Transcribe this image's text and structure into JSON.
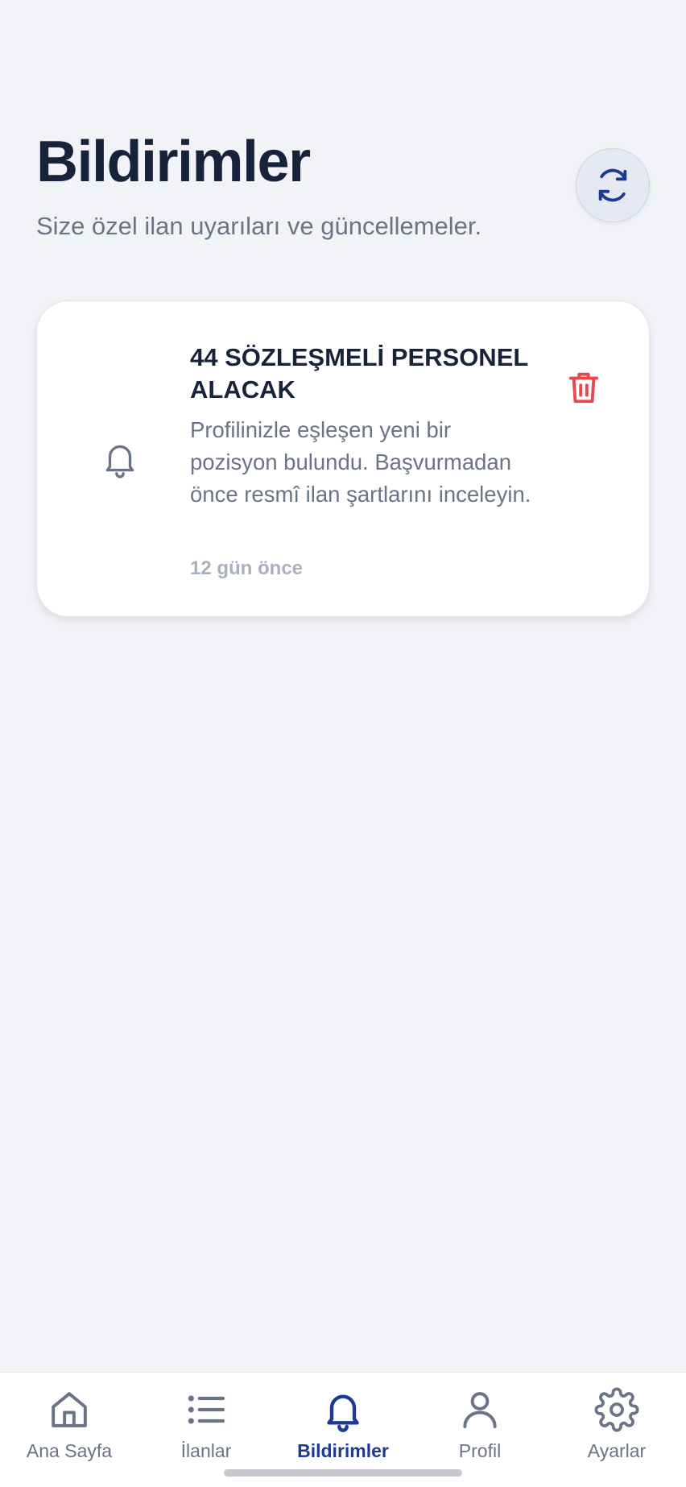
{
  "header": {
    "title": "Bildirimler",
    "subtitle": "Size özel ilan uyarıları ve güncellemeler.",
    "refresh_icon": "refresh-icon"
  },
  "notifications": [
    {
      "title": "44 SÖZLEŞMELİ PERSONEL ALACAK",
      "message": "Profilinizle eşleşen yeni bir pozisyon bulundu. Başvurmadan önce resmî ilan şartlarını inceleyin.",
      "time": "12 gün önce",
      "icon": "bell-icon",
      "delete_icon": "trash-icon"
    }
  ],
  "tabbar": {
    "items": [
      {
        "label": "Ana Sayfa",
        "icon": "home-icon",
        "active": false
      },
      {
        "label": "İlanlar",
        "icon": "list-icon",
        "active": false
      },
      {
        "label": "Bildirimler",
        "icon": "bell-icon",
        "active": true
      },
      {
        "label": "Profil",
        "icon": "user-icon",
        "active": false
      },
      {
        "label": "Ayarlar",
        "icon": "gear-icon",
        "active": false
      }
    ]
  },
  "colors": {
    "background": "#f2f3f6",
    "title": "#17233b",
    "muted": "#6b7386",
    "accent": "#1d3a91",
    "danger": "#e5484d"
  }
}
